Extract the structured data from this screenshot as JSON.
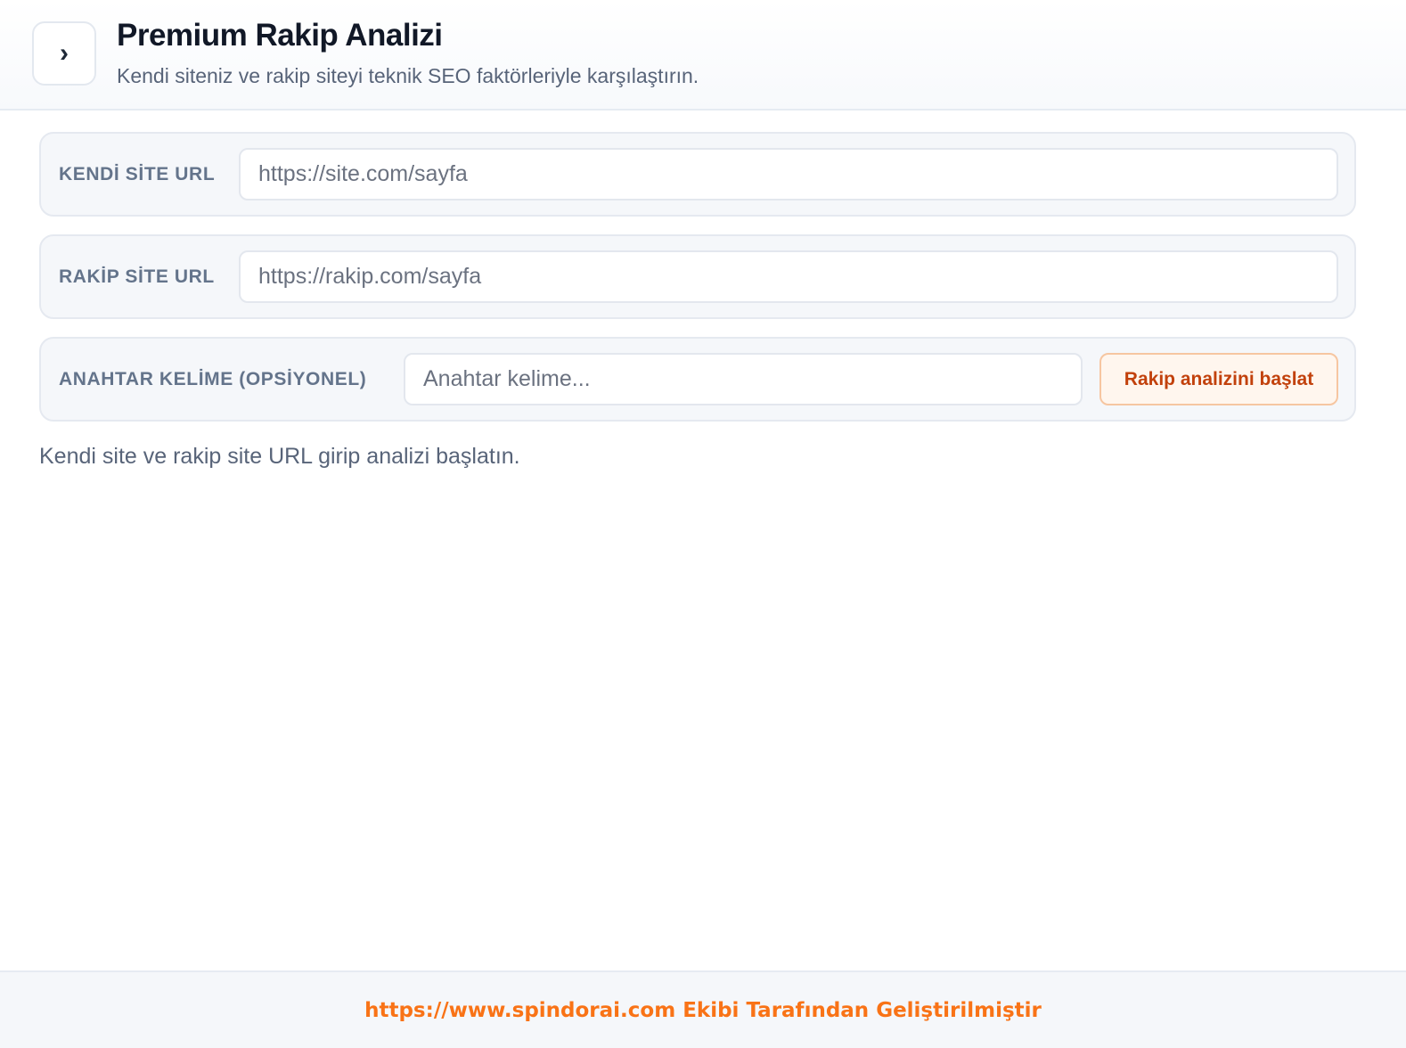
{
  "header": {
    "toggle_icon": "›",
    "title": "Premium Rakip Analizi",
    "subtitle": "Kendi siteniz ve rakip siteyi teknik SEO faktörleriyle karşılaştırın."
  },
  "form": {
    "own_site": {
      "label": "KENDİ SİTE URL",
      "placeholder": "https://site.com/sayfa",
      "value": ""
    },
    "competitor_site": {
      "label": "RAKİP SİTE URL",
      "placeholder": "https://rakip.com/sayfa",
      "value": ""
    },
    "keyword": {
      "label": "ANAHTAR KELİME (OPSİYONEL)",
      "placeholder": "Anahtar kelime...",
      "value": ""
    },
    "start_button_label": "Rakip analizini başlat"
  },
  "hint": "Kendi site ve rakip site URL girip analizi başlatın.",
  "footer": {
    "text": "https://www.spindorai.com Ekibi Tarafından Geliştirilmiştir"
  },
  "colors": {
    "accent": "#f97316",
    "button_text": "#c2410c"
  }
}
